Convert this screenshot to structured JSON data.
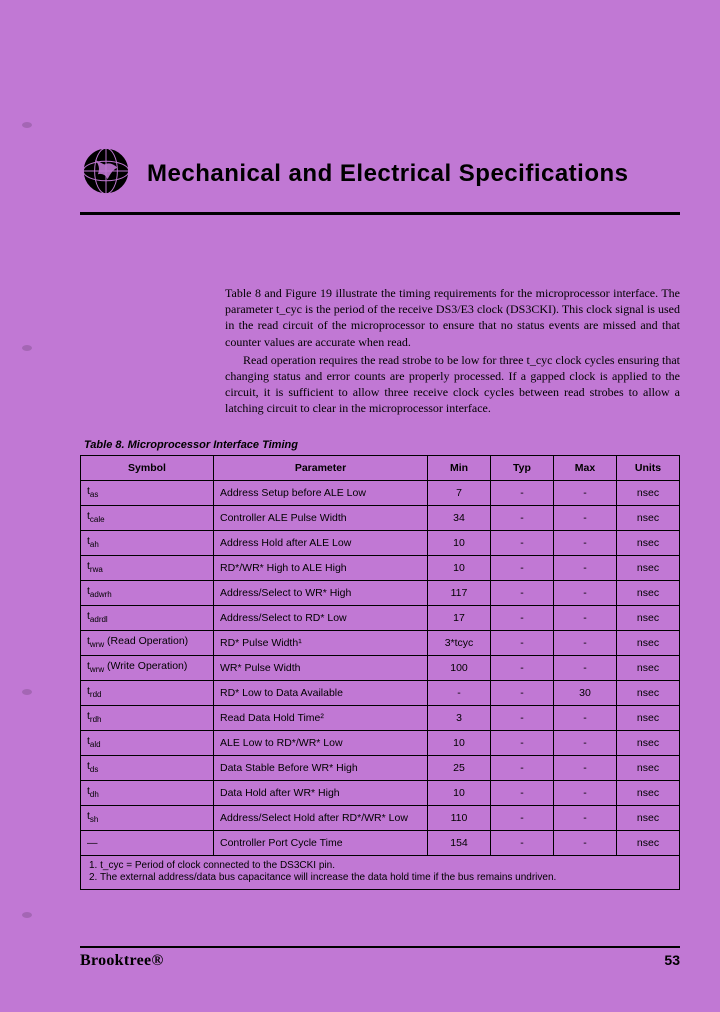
{
  "header": {
    "title": "Mechanical and Electrical Specifications"
  },
  "body": {
    "p1": "Table 8 and Figure 19 illustrate the timing requirements for the microprocessor interface. The parameter t_cyc is the period of the receive DS3/E3 clock (DS3CKI). This clock signal is used in the read circuit of the microprocessor to ensure that no status events are missed and that counter values are accurate when read.",
    "p2": "Read operation requires the read strobe to be low for three t_cyc clock cycles ensuring that changing status and error counts are properly processed. If a gapped clock is applied to the circuit, it is sufficient to allow three receive clock cycles between read strobes to allow a latching circuit to clear in the microprocessor interface."
  },
  "table": {
    "caption": "Table 8.  Microprocessor Interface Timing",
    "headers": [
      "Symbol",
      "Parameter",
      "Min",
      "Typ",
      "Max",
      "Units"
    ],
    "rows": [
      {
        "sym_base": "t",
        "sym_sub": "as",
        "sym_suffix": "",
        "param": "Address Setup before ALE Low",
        "min": "7",
        "typ": "-",
        "max": "-",
        "units": "nsec"
      },
      {
        "sym_base": "t",
        "sym_sub": "cale",
        "sym_suffix": "",
        "param": "Controller ALE Pulse Width",
        "min": "34",
        "typ": "-",
        "max": "-",
        "units": "nsec"
      },
      {
        "sym_base": "t",
        "sym_sub": "ah",
        "sym_suffix": "",
        "param": "Address Hold after ALE Low",
        "min": "10",
        "typ": "-",
        "max": "-",
        "units": "nsec"
      },
      {
        "sym_base": "t",
        "sym_sub": "rwa",
        "sym_suffix": "",
        "param": "RD*/WR* High to ALE High",
        "min": "10",
        "typ": "-",
        "max": "-",
        "units": "nsec"
      },
      {
        "sym_base": "t",
        "sym_sub": "adwrh",
        "sym_suffix": "",
        "param": "Address/Select to WR* High",
        "min": "117",
        "typ": "-",
        "max": "-",
        "units": "nsec"
      },
      {
        "sym_base": "t",
        "sym_sub": "adrdl",
        "sym_suffix": "",
        "param": "Address/Select to RD* Low",
        "min": "17",
        "typ": "-",
        "max": "-",
        "units": "nsec"
      },
      {
        "sym_base": "t",
        "sym_sub": "wrw",
        "sym_suffix": " (Read Operation)",
        "param": "RD* Pulse Width¹",
        "min": "3*tcyc",
        "typ": "-",
        "max": "-",
        "units": "nsec"
      },
      {
        "sym_base": "t",
        "sym_sub": "wrw",
        "sym_suffix": " (Write Operation)",
        "param": "WR* Pulse Width",
        "min": "100",
        "typ": "-",
        "max": "-",
        "units": "nsec"
      },
      {
        "sym_base": "t",
        "sym_sub": "rdd",
        "sym_suffix": "",
        "param": "RD* Low to Data Available",
        "min": "-",
        "typ": "-",
        "max": "30",
        "units": "nsec"
      },
      {
        "sym_base": "t",
        "sym_sub": "rdh",
        "sym_suffix": "",
        "param": "Read Data Hold Time²",
        "min": "3",
        "typ": "-",
        "max": "-",
        "units": "nsec"
      },
      {
        "sym_base": "t",
        "sym_sub": "ald",
        "sym_suffix": "",
        "param": "ALE Low to RD*/WR* Low",
        "min": "10",
        "typ": "-",
        "max": "-",
        "units": "nsec"
      },
      {
        "sym_base": "t",
        "sym_sub": "ds",
        "sym_suffix": "",
        "param": "Data Stable Before WR* High",
        "min": "25",
        "typ": "-",
        "max": "-",
        "units": "nsec"
      },
      {
        "sym_base": "t",
        "sym_sub": "dh",
        "sym_suffix": "",
        "param": "Data Hold after WR* High",
        "min": "10",
        "typ": "-",
        "max": "-",
        "units": "nsec"
      },
      {
        "sym_base": "t",
        "sym_sub": "sh",
        "sym_suffix": "",
        "param": "Address/Select Hold after RD*/WR* Low",
        "min": "110",
        "typ": "-",
        "max": "-",
        "units": "nsec"
      },
      {
        "sym_base": "—",
        "sym_sub": "",
        "sym_suffix": "",
        "param": "Controller Port Cycle Time",
        "min": "154",
        "typ": "-",
        "max": "-",
        "units": "nsec"
      }
    ],
    "footnotes": {
      "n1": "1.  t_cyc = Period of clock connected to the DS3CKI pin.",
      "n2": "2.  The external address/data bus capacitance will increase the data hold time if the bus remains undriven."
    }
  },
  "footer": {
    "brand": "Brooktree®",
    "page": "53"
  }
}
